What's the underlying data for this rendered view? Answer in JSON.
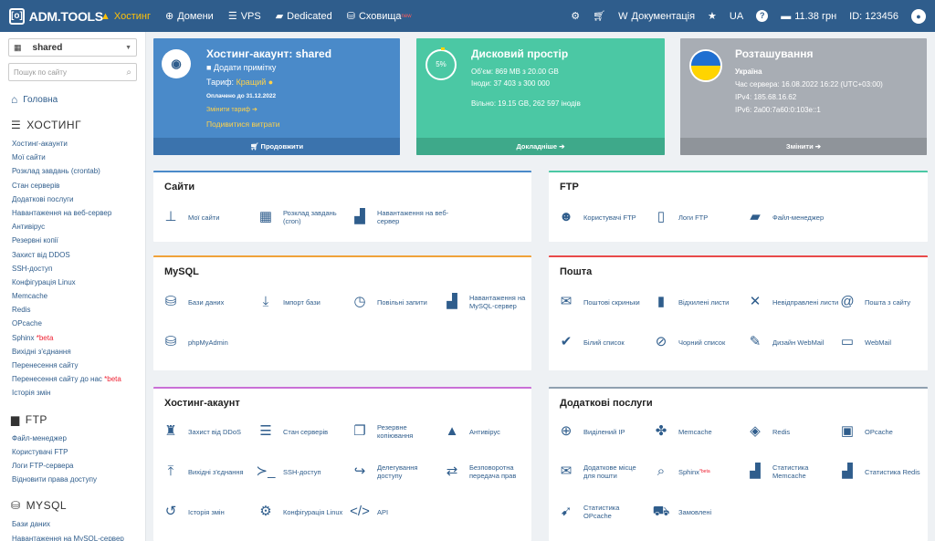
{
  "topbar": {
    "logo_text": "ADM.TOOLS",
    "nav": [
      {
        "label": "Хостинг",
        "icon": "hosting-icon",
        "active": true
      },
      {
        "label": "Домени",
        "icon": "globe-icon"
      },
      {
        "label": "VPS",
        "icon": "server-icon"
      },
      {
        "label": "Dedicated",
        "icon": "dedicated-icon"
      },
      {
        "label": "Сховища",
        "icon": "storage-icon",
        "badge": "new"
      }
    ],
    "docs_label": "Документація",
    "lang": "UA",
    "balance": "11.38 грн",
    "id_label": "ID: 123456",
    "help": "?"
  },
  "sidebar": {
    "account_select": "shared",
    "search_placeholder": "Пошук по сайту",
    "home": "Головна",
    "sections": [
      {
        "title": "ХОСТИНГ",
        "icon": "hosting-section-icon",
        "items": [
          "Хостинг-акаунти",
          "Мої сайти",
          "Розклад завдань (crontab)",
          "Стан серверів",
          "Додаткові послуги",
          "Навантаження на веб-сервер",
          "Антивірус",
          "Резервні копії",
          "Захист від DDOS",
          "SSH-доступ",
          "Конфігурація Linux",
          "Memcache",
          "Redis",
          "OPcache",
          "Sphinx",
          "Вихідні з'єднання",
          "Перенесення сайту",
          "Перенесення сайту до нас",
          "Історія змін"
        ]
      },
      {
        "title": "FTP",
        "icon": "folder-icon",
        "items": [
          "Файл-менеджер",
          "Користувачі FTP",
          "Логи FTP-сервера",
          "Відновити права доступу"
        ]
      },
      {
        "title": "MYSQL",
        "icon": "database-icon",
        "items": [
          "Бази даних",
          "Навантаження на MySQL-сервер"
        ]
      }
    ],
    "beta": "*beta"
  },
  "tiles": {
    "account": {
      "title": "Хостинг-акаунт: shared",
      "note": "Додати примітку",
      "tariff_label": "Тариф:",
      "tariff": "Кращий",
      "paid": "Оплачено до 31.12.2022",
      "change_tariff": "Змінити тариф",
      "costs": "Подивитися витрати",
      "footer": "Продовжити"
    },
    "disk": {
      "title": "Дисковий простір",
      "percent": "5%",
      "percent_value": 5,
      "volume": "Об'єм: 869 MB з 20.00 GB",
      "inodes": "Іноди: 37 403 з 300 000",
      "free": "Вільно: 19.15 GB, 262 597 інодів",
      "footer": "Докладніше"
    },
    "location": {
      "title": "Розташування",
      "country": "Україна",
      "time": "Час сервера: 16.08.2022 16:22 (UTC+03:00)",
      "ipv4": "IPv4: 185.68.16.62",
      "ipv6": "IPv6: 2a00:7a60:0:103e::1",
      "footer": "Змінити"
    }
  },
  "cards": {
    "sites": {
      "title": "Сайти",
      "items": [
        {
          "label": "Мої сайти",
          "icon": "sitemap-icon"
        },
        {
          "label": "Розклад завдань (cron)",
          "icon": "calendar-icon"
        },
        {
          "label": "Навантаження на веб-сервер",
          "icon": "chart-icon"
        }
      ]
    },
    "ftp": {
      "title": "FTP",
      "items": [
        {
          "label": "Користувачі FTP",
          "icon": "users-icon"
        },
        {
          "label": "Логи FTP",
          "icon": "file-icon"
        },
        {
          "label": "Файл-менеджер",
          "icon": "folder-open-icon"
        }
      ]
    },
    "mysql": {
      "title": "MySQL",
      "items": [
        {
          "label": "Бази даних",
          "icon": "database-icon"
        },
        {
          "label": "Імпорт бази",
          "icon": "download-icon"
        },
        {
          "label": "Повільні запити",
          "icon": "clock-icon"
        },
        {
          "label": "Навантаження на MySQL-сервер",
          "icon": "chart-icon"
        },
        {
          "label": "phpMyAdmin",
          "icon": "database-icon"
        }
      ]
    },
    "mail": {
      "title": "Пошта",
      "items": [
        {
          "label": "Поштові скриньки",
          "icon": "envelope-icon"
        },
        {
          "label": "Відхилені листи",
          "icon": "trash-icon"
        },
        {
          "label": "Невідправлені листи",
          "icon": "x-icon"
        },
        {
          "label": "Пошта з сайту",
          "icon": "at-icon"
        },
        {
          "label": "Білий список",
          "icon": "check-icon"
        },
        {
          "label": "Чорний список",
          "icon": "ban-icon"
        },
        {
          "label": "Дизайн WebMail",
          "icon": "brush-icon"
        },
        {
          "label": "WebMail",
          "icon": "inbox-icon"
        }
      ]
    },
    "account": {
      "title": "Хостинг-акаунт",
      "items": [
        {
          "label": "Захист від DDoS",
          "icon": "castle-icon"
        },
        {
          "label": "Стан серверів",
          "icon": "server-icon"
        },
        {
          "label": "Резервне копіювання",
          "icon": "copy-icon"
        },
        {
          "label": "Антивірус",
          "icon": "lock-icon"
        },
        {
          "label": "Вихідні з'єднання",
          "icon": "upload-icon"
        },
        {
          "label": "SSH-доступ",
          "icon": "terminal-icon"
        },
        {
          "label": "Делегування доступу",
          "icon": "share-icon"
        },
        {
          "label": "Безповоротна передача прав",
          "icon": "exchange-icon"
        },
        {
          "label": "Історія змін",
          "icon": "history-icon"
        },
        {
          "label": "Конфігурація Linux",
          "icon": "cog-icon"
        },
        {
          "label": "API",
          "icon": "code-icon"
        }
      ]
    },
    "extras": {
      "title": "Додаткові послуги",
      "items": [
        {
          "label": "Виділений IP",
          "icon": "globe-icon"
        },
        {
          "label": "Memcache",
          "icon": "cubes-icon"
        },
        {
          "label": "Redis",
          "icon": "cube-icon"
        },
        {
          "label": "OPcache",
          "icon": "chip-icon"
        },
        {
          "label": "Додаткове місце для пошти",
          "icon": "mail-plus-icon"
        },
        {
          "label": "Sphinx",
          "icon": "search-icon"
        },
        {
          "label": "Статистика Memcache",
          "icon": "chart-icon"
        },
        {
          "label": "Статистика Redis",
          "icon": "chart-icon"
        },
        {
          "label": "Статистика OPcache",
          "icon": "rocket-icon"
        },
        {
          "label": "Замовлені",
          "icon": "cart-icon"
        }
      ]
    }
  },
  "colors": {
    "topbar": "#2f5d8c",
    "accent": "#4a8ac9",
    "green": "#4bc8a4",
    "gray": "#a8adb4",
    "active_nav": "#ffc107",
    "beta": "#e23333"
  }
}
